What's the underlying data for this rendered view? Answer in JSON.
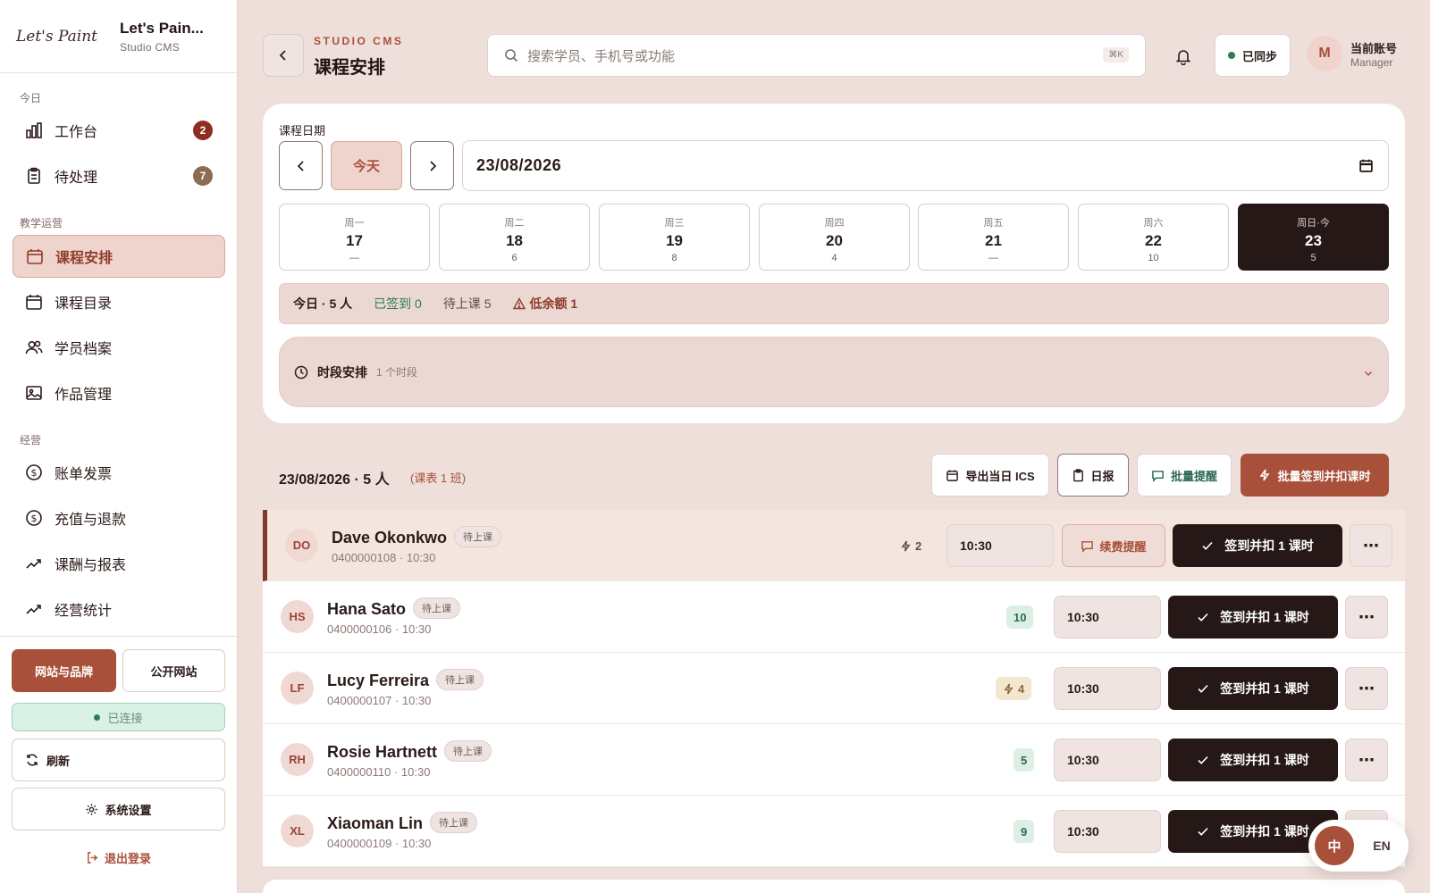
{
  "brand": {
    "script": "Let's Paint",
    "title": "Let's Pain...",
    "subtitle": "Studio CMS"
  },
  "sidebar": {
    "sections": [
      "今日",
      "教学运营",
      "经营"
    ],
    "items": [
      {
        "label": "工作台",
        "icon": "bar-chart-icon",
        "badge": "2"
      },
      {
        "label": "待处理",
        "icon": "clipboard-icon",
        "badge": "7"
      },
      {
        "label": "课程安排",
        "icon": "calendar-icon",
        "active": true
      },
      {
        "label": "课程目录",
        "icon": "calendar-icon"
      },
      {
        "label": "学员档案",
        "icon": "users-icon"
      },
      {
        "label": "作品管理",
        "icon": "image-icon"
      },
      {
        "label": "账单发票",
        "icon": "dollar-icon"
      },
      {
        "label": "充值与退款",
        "icon": "dollar-icon"
      },
      {
        "label": "课酬与报表",
        "icon": "trend-icon"
      },
      {
        "label": "经营统计",
        "icon": "trend-icon"
      }
    ],
    "website_brand": "网站与品牌",
    "public_site": "公开网站",
    "connected": "已连接",
    "refresh": "刷新",
    "settings": "系统设置",
    "logout": "退出登录"
  },
  "header": {
    "eyebrow": "STUDIO CMS",
    "title": "课程安排",
    "search_placeholder": "搜索学员、手机号或功能",
    "shortcut": "⌘K",
    "sync": "已同步",
    "account_initial": "M",
    "account_name": "当前账号",
    "account_role": "Manager"
  },
  "date_panel": {
    "label": "课程日期",
    "today_btn": "今天",
    "date_value": "23/08/2026",
    "days": [
      {
        "weekday": "周一",
        "day": "17",
        "count": "—"
      },
      {
        "weekday": "周二",
        "day": "18",
        "count": "6"
      },
      {
        "weekday": "周三",
        "day": "19",
        "count": "8"
      },
      {
        "weekday": "周四",
        "day": "20",
        "count": "4"
      },
      {
        "weekday": "周五",
        "day": "21",
        "count": "—"
      },
      {
        "weekday": "周六",
        "day": "22",
        "count": "10"
      },
      {
        "weekday": "周日·今",
        "day": "23",
        "count": "5"
      }
    ],
    "summary_today": "今日 · 5 人",
    "summary_checked": "已签到 0",
    "summary_pending": "待上课 5",
    "summary_low": "低余额 1",
    "slots_title": "时段安排",
    "slots_count": "1 个时段"
  },
  "list": {
    "heading": "23/08/2026 · 5 人",
    "sub": "(课表 1 班)",
    "export_ics": "导出当日 ICS",
    "daily": "日报",
    "batch_remind": "批量提醒",
    "batch_checkin": "批量签到并扣课时",
    "renew": "续费提醒",
    "checkin_label": "签到并扣 1 课时",
    "students": [
      {
        "initials": "DO",
        "name": "Dave Okonkwo",
        "status": "待上课",
        "phone": "0400000108 · 10:30",
        "credits": "2",
        "time": "10:30"
      },
      {
        "initials": "HS",
        "name": "Hana Sato",
        "status": "待上课",
        "phone": "0400000106 · 10:30",
        "credits": "10",
        "time": "10:30"
      },
      {
        "initials": "LF",
        "name": "Lucy Ferreira",
        "status": "待上课",
        "phone": "0400000107 · 10:30",
        "credits": "4",
        "time": "10:30"
      },
      {
        "initials": "RH",
        "name": "Rosie Hartnett",
        "status": "待上课",
        "phone": "0400000110 · 10:30",
        "credits": "5",
        "time": "10:30"
      },
      {
        "initials": "XL",
        "name": "Xiaoman Lin",
        "status": "待上课",
        "phone": "0400000109 · 10:30",
        "credits": "9",
        "time": "10:30"
      }
    ]
  },
  "lang": {
    "zh": "中",
    "en": "EN"
  },
  "colors": {
    "accent": "#a85039",
    "dark": "#261816",
    "bg": "#eedfdb",
    "success": "#2e7d4f"
  }
}
